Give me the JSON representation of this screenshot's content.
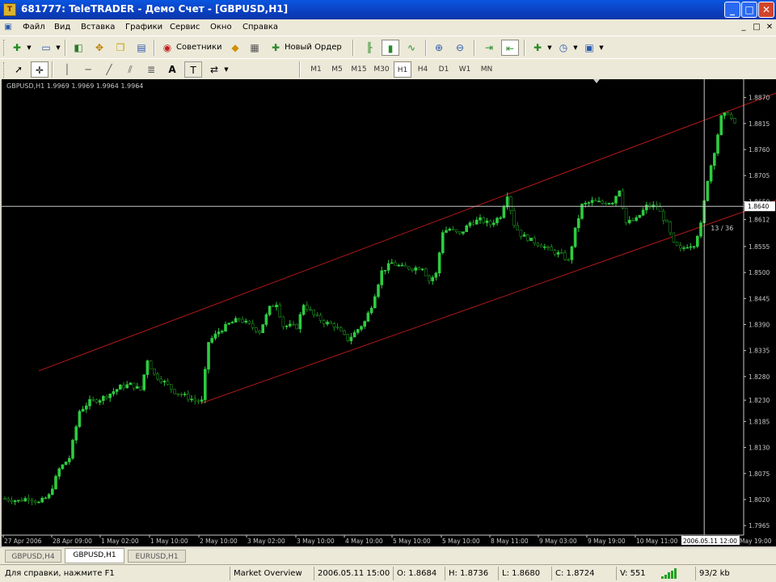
{
  "window": {
    "title": "681777: TeleTRADER - Демо Счет - [GBPUSD,H1]",
    "app_icon": "teletrader-icon",
    "minimize_label": "_",
    "maximize_label": "□",
    "close_label": "✕"
  },
  "menu": {
    "items": [
      "Файл",
      "Вид",
      "Вставка",
      "Графики",
      "Сервис",
      "Окно",
      "Справка"
    ],
    "mdi": [
      "_",
      "□",
      "✕"
    ]
  },
  "toolbar": {
    "experts_label": "Советники",
    "new_order_label": "Новый Ордер"
  },
  "drawing_toolbar": {
    "text_tool": "A",
    "label_tool": "T"
  },
  "timeframes": [
    "M1",
    "M5",
    "M15",
    "M30",
    "H1",
    "H4",
    "D1",
    "W1",
    "MN"
  ],
  "active_timeframe": "H1",
  "chart": {
    "info_label": "GBPUSD,H1  1.9969 1.9969 1.9964 1.9964",
    "crosshair_price": "1.8640",
    "crosshair_readout": "13 / 36",
    "crosshair_time_label": "2006.05.11 12:00",
    "colors": {
      "background": "#000000",
      "bull_candle": "#2ecc40",
      "bear_candle": "#1e8c1e",
      "channel": "#b01818",
      "crosshair": "#c8c8c8",
      "axis_text": "#c8c8c8"
    }
  },
  "chart_data": {
    "type": "candlestick",
    "symbol": "GBPUSD",
    "timeframe": "H1",
    "x_labels": [
      "27 Apr 2006",
      "28 Apr 09:00",
      "1 May 02:00",
      "1 May 10:00",
      "2 May 10:00",
      "3 May 02:00",
      "3 May 10:00",
      "4 May 10:00",
      "5 May 10:00",
      "5 May 10:00",
      "8 May 11:00",
      "9 May 03:00",
      "9 May 19:00",
      "10 May 11:00",
      "2006.05.11 12:00",
      "May 19:00"
    ],
    "y_ticks": [
      1.887,
      1.8815,
      1.876,
      1.8705,
      1.865,
      1.8612,
      1.8555,
      1.85,
      1.8445,
      1.839,
      1.8335,
      1.828,
      1.823,
      1.8185,
      1.813,
      1.8075,
      1.802,
      1.7965
    ],
    "ylim": [
      1.7955,
      1.8895
    ],
    "close_path": [
      [
        0,
        1.8022
      ],
      [
        4,
        1.8017
      ],
      [
        7,
        1.8024
      ],
      [
        10,
        1.8013
      ],
      [
        13,
        1.8028
      ],
      [
        16,
        1.8084
      ],
      [
        19,
        1.8108
      ],
      [
        22,
        1.8207
      ],
      [
        25,
        1.8227
      ],
      [
        28,
        1.8232
      ],
      [
        31,
        1.8244
      ],
      [
        34,
        1.8258
      ],
      [
        37,
        1.8263
      ],
      [
        40,
        1.8252
      ],
      [
        42,
        1.8316
      ],
      [
        44,
        1.8284
      ],
      [
        47,
        1.8268
      ],
      [
        50,
        1.8248
      ],
      [
        53,
        1.8239
      ],
      [
        56,
        1.8229
      ],
      [
        58,
        1.8228
      ],
      [
        60,
        1.8353
      ],
      [
        63,
        1.8375
      ],
      [
        66,
        1.8391
      ],
      [
        69,
        1.8402
      ],
      [
        72,
        1.8389
      ],
      [
        75,
        1.8375
      ],
      [
        78,
        1.8425
      ],
      [
        80,
        1.8435
      ],
      [
        82,
        1.8387
      ],
      [
        84,
        1.8387
      ],
      [
        86,
        1.8385
      ],
      [
        88,
        1.8433
      ],
      [
        91,
        1.841
      ],
      [
        94,
        1.8395
      ],
      [
        97,
        1.8388
      ],
      [
        99,
        1.8373
      ],
      [
        101,
        1.8358
      ],
      [
        103,
        1.8372
      ],
      [
        106,
        1.8396
      ],
      [
        108,
        1.843
      ],
      [
        111,
        1.8502
      ],
      [
        114,
        1.852
      ],
      [
        117,
        1.8511
      ],
      [
        120,
        1.8509
      ],
      [
        123,
        1.8511
      ],
      [
        125,
        1.8483
      ],
      [
        127,
        1.8497
      ],
      [
        129,
        1.8587
      ],
      [
        131,
        1.8592
      ],
      [
        134,
        1.858
      ],
      [
        137,
        1.8605
      ],
      [
        140,
        1.8611
      ],
      [
        143,
        1.8602
      ],
      [
        146,
        1.862
      ],
      [
        148,
        1.8665
      ],
      [
        150,
        1.8602
      ],
      [
        152,
        1.858
      ],
      [
        155,
        1.8568
      ],
      [
        158,
        1.8558
      ],
      [
        161,
        1.8545
      ],
      [
        164,
        1.8537
      ],
      [
        166,
        1.8524
      ],
      [
        168,
        1.859
      ],
      [
        170,
        1.8642
      ],
      [
        173,
        1.865
      ],
      [
        176,
        1.8647
      ],
      [
        179,
        1.865
      ],
      [
        181,
        1.8676
      ],
      [
        183,
        1.8605
      ],
      [
        186,
        1.8612
      ],
      [
        189,
        1.864
      ],
      [
        192,
        1.864
      ],
      [
        195,
        1.8602
      ],
      [
        197,
        1.856
      ],
      [
        199,
        1.8548
      ],
      [
        201,
        1.8557
      ],
      [
        203,
        1.856
      ],
      [
        205,
        1.8601
      ],
      [
        207,
        1.8697
      ],
      [
        209,
        1.8757
      ],
      [
        211,
        1.8828
      ],
      [
        213,
        1.8838
      ],
      [
        215,
        1.8812
      ]
    ],
    "channel_upper": [
      [
        10,
        1.8292
      ],
      [
        230,
        1.8887
      ]
    ],
    "channel_lower": [
      [
        58,
        1.8224
      ],
      [
        230,
        1.866
      ]
    ],
    "crosshair": {
      "price": 1.864,
      "bar": 206
    }
  },
  "tabs": [
    "GBPUSD,H4",
    "GBPUSD,H1",
    "EURUSD,H1"
  ],
  "active_tab": "GBPUSD,H1",
  "status": {
    "help": "Для справки, нажмите F1",
    "profile": "Market Overview",
    "datetime": "2006.05.11 15:00",
    "open": "O: 1.8684",
    "high": "H: 1.8736",
    "low": "L: 1.8680",
    "close": "C: 1.8724",
    "volume": "V: 551",
    "traffic": "93/2 kb"
  }
}
